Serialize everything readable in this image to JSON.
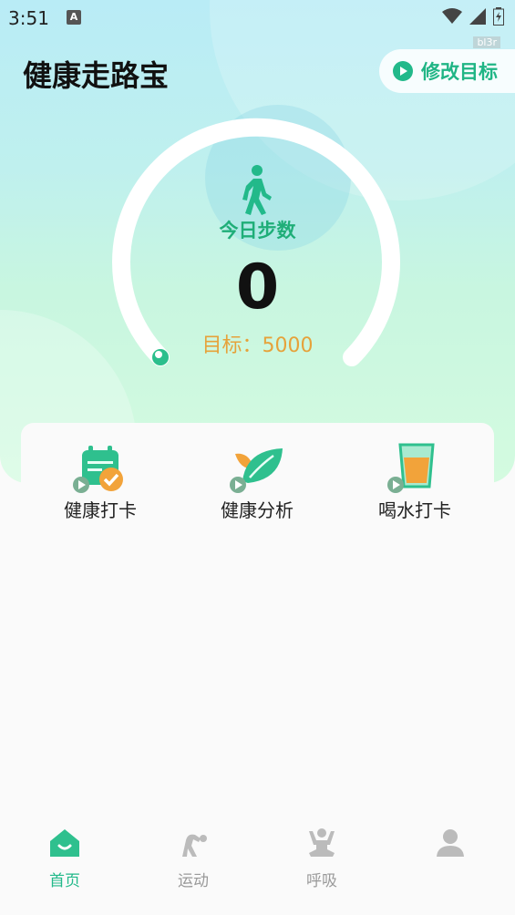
{
  "status_bar": {
    "time": "3:51",
    "notification_icon": "A"
  },
  "watermark": "bl3r",
  "header": {
    "title": "健康走路宝",
    "edit_goal_label": "修改目标"
  },
  "gauge": {
    "label": "今日步数",
    "steps": "0",
    "goal_text": "目标：5000",
    "progress": 0
  },
  "quick_actions": [
    {
      "label": "健康打卡",
      "icon": "calendar-check-icon"
    },
    {
      "label": "健康分析",
      "icon": "leaf-icon"
    },
    {
      "label": "喝水打卡",
      "icon": "water-cup-icon"
    }
  ],
  "tabs": [
    {
      "label": "首页",
      "icon": "home-icon",
      "active": true
    },
    {
      "label": "运动",
      "icon": "exercise-icon",
      "active": false
    },
    {
      "label": "呼吸",
      "icon": "meditation-icon",
      "active": false
    },
    {
      "label": "",
      "icon": "profile-icon",
      "active": false
    }
  ],
  "colors": {
    "accent": "#22b98a",
    "goal": "#e6a23a",
    "text": "#111111"
  }
}
